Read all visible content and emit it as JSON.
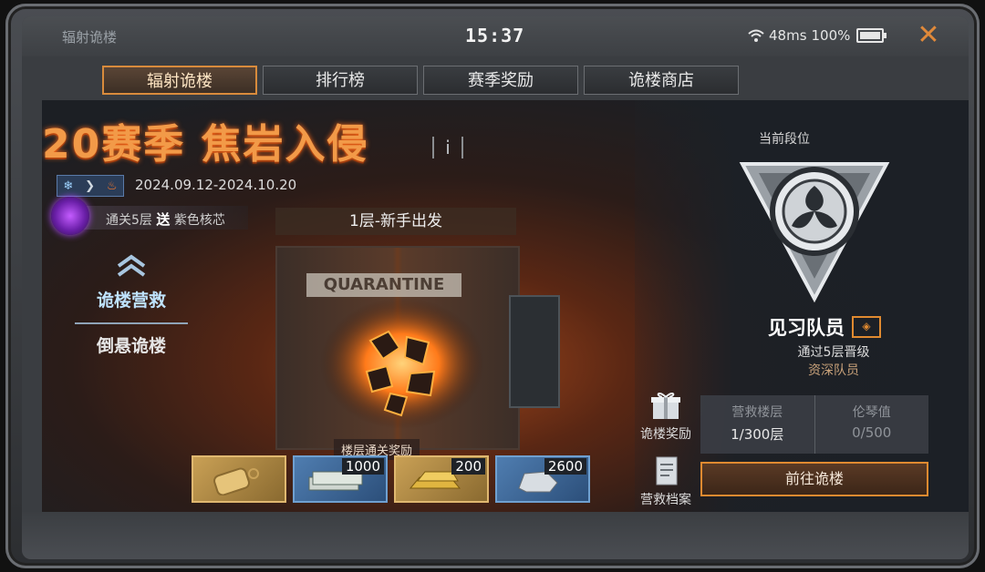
{
  "status": {
    "app_title": "辐射诡楼",
    "time": "15:37",
    "ping": "48ms",
    "battery": "100%"
  },
  "tabs": [
    {
      "label": "辐射诡楼",
      "active": true
    },
    {
      "label": "排行榜",
      "active": false
    },
    {
      "label": "赛季奖励",
      "active": false
    },
    {
      "label": "诡楼商店",
      "active": false
    }
  ],
  "season": {
    "title": "20赛季 焦岩入侵",
    "info_label": "i",
    "dates": "2024.09.12-2024.10.20",
    "promo_prefix": "通关5层",
    "promo_send": "送",
    "promo_item": "紫色核芯"
  },
  "side_nav": [
    {
      "label": "诡楼营救",
      "active": true
    },
    {
      "label": "倒悬诡楼",
      "active": false
    }
  ],
  "floor": {
    "label": "1层-新手出发",
    "door_sign": "QUARANTINE"
  },
  "rewards": {
    "title": "楼层通关奖励",
    "items": [
      {
        "icon": "dog-tag-icon",
        "count": ""
      },
      {
        "icon": "cash-stack-icon",
        "count": "1000"
      },
      {
        "icon": "gold-bar-icon",
        "count": "200"
      },
      {
        "icon": "silver-ore-icon",
        "count": "2600"
      }
    ]
  },
  "side_buttons": {
    "reward": "诡楼奖励",
    "archive": "营救档案"
  },
  "rank": {
    "title": "当前段位",
    "name": "见习队员",
    "promo_line": "通过5层晋级",
    "next": "资深队员"
  },
  "stats": {
    "floor_label": "营救楼层",
    "floor_value": "1/300层",
    "piano_label": "伦琴值",
    "piano_value": "0/500"
  },
  "go_button": "前往诡楼",
  "colors": {
    "accent": "#e08a30",
    "title_orange": "#f29a48"
  }
}
